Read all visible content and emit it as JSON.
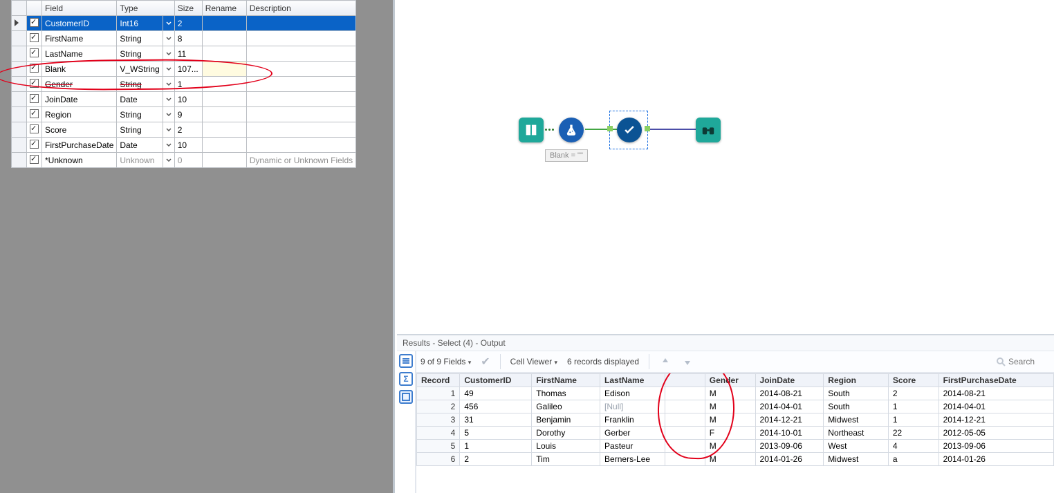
{
  "fields_table": {
    "headers": {
      "field": "Field",
      "type": "Type",
      "size": "Size",
      "rename": "Rename",
      "desc": "Description"
    },
    "rows": [
      {
        "checked": true,
        "field": "CustomerID",
        "type": "Int16",
        "size": "2",
        "rename": "",
        "desc": "",
        "selected": true
      },
      {
        "checked": true,
        "field": "FirstName",
        "type": "String",
        "size": "8",
        "rename": "",
        "desc": ""
      },
      {
        "checked": true,
        "field": "LastName",
        "type": "String",
        "size": "11",
        "rename": "",
        "desc": ""
      },
      {
        "checked": true,
        "field": "Blank",
        "type": "V_WString",
        "size": "107...",
        "rename": "",
        "desc": "",
        "rename_hl": true
      },
      {
        "checked": true,
        "field": "Gender",
        "type": "String",
        "size": "1",
        "rename": "",
        "desc": "",
        "strike": true
      },
      {
        "checked": true,
        "field": "JoinDate",
        "type": "Date",
        "size": "10",
        "rename": "",
        "desc": ""
      },
      {
        "checked": true,
        "field": "Region",
        "type": "String",
        "size": "9",
        "rename": "",
        "desc": ""
      },
      {
        "checked": true,
        "field": "Score",
        "type": "String",
        "size": "2",
        "rename": "",
        "desc": ""
      },
      {
        "checked": true,
        "field": "FirstPurchaseDate",
        "type": "Date",
        "size": "10",
        "rename": "",
        "desc": ""
      },
      {
        "checked": true,
        "field": "*Unknown",
        "type": "Unknown",
        "size": "0",
        "rename": "",
        "desc": "Dynamic or Unknown Fields",
        "unknown": true
      }
    ]
  },
  "canvas": {
    "annotation": "Blank = \"\"",
    "tools": [
      "input",
      "formula",
      "select",
      "browse"
    ]
  },
  "results": {
    "title": "Results - Select (4) - Output",
    "fields_summary": "9 of 9 Fields",
    "cell_viewer": "Cell Viewer",
    "records_displayed": "6 records displayed",
    "search_placeholder": "Search",
    "headers": [
      "Record",
      "CustomerID",
      "FirstName",
      "LastName",
      "",
      "Gender",
      "JoinDate",
      "Region",
      "Score",
      "FirstPurchaseDate"
    ],
    "rows": [
      {
        "rec": 1,
        "cells": [
          "49",
          "Thomas",
          "Edison",
          "",
          "M",
          "2014-08-21",
          "South",
          "2",
          "2014-08-21"
        ]
      },
      {
        "rec": 2,
        "cells": [
          "456",
          "Galileo",
          "[Null]",
          "",
          "M",
          "2014-04-01",
          "South",
          "1",
          "2014-04-01"
        ],
        "null_cols": [
          2
        ]
      },
      {
        "rec": 3,
        "cells": [
          "31",
          "Benjamin",
          "Franklin",
          "",
          "M",
          "2014-12-21",
          "Midwest",
          "1",
          "2014-12-21"
        ]
      },
      {
        "rec": 4,
        "cells": [
          "5",
          "Dorothy",
          "Gerber",
          "",
          "F",
          "2014-10-01",
          "Northeast",
          "22",
          "2012-05-05"
        ]
      },
      {
        "rec": 5,
        "cells": [
          "1",
          "Louis",
          "Pasteur",
          "",
          "M",
          "2013-09-06",
          "West",
          "4",
          "2013-09-06"
        ]
      },
      {
        "rec": 6,
        "cells": [
          "2",
          "Tim",
          "Berners-Lee",
          "",
          "M",
          "2014-01-26",
          "Midwest",
          "a",
          "2014-01-26"
        ]
      }
    ]
  }
}
